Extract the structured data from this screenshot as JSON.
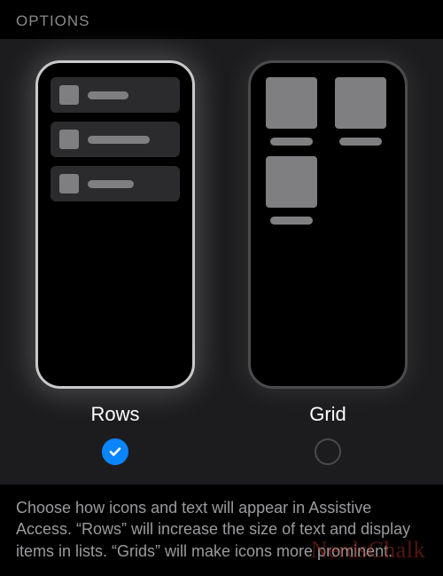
{
  "section_header": "OPTIONS",
  "options": {
    "rows": {
      "label": "Rows",
      "selected": true
    },
    "grid": {
      "label": "Grid",
      "selected": false
    }
  },
  "footer_text": "Choose how icons and text will appear in Assistive Access. “Rows” will increase the size of text and display items in lists. “Grids” will make icons more prominent.",
  "watermark": "NerdsChalk",
  "colors": {
    "accent": "#0a84ff",
    "panel": "#1c1c1e",
    "muted_text": "#8a8a8e"
  }
}
